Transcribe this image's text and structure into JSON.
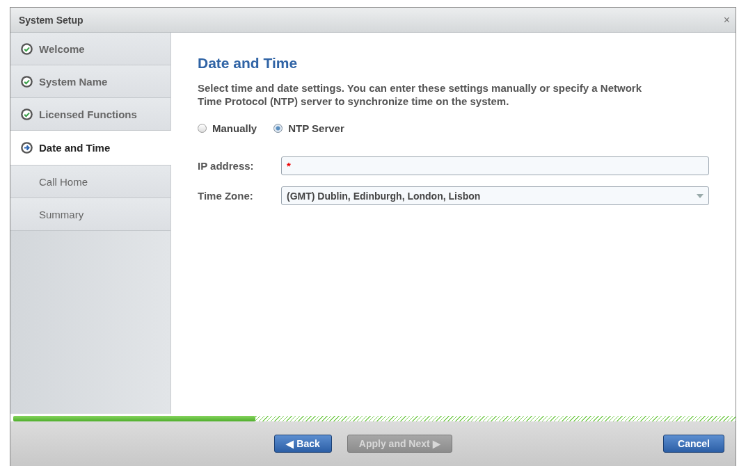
{
  "window": {
    "title": "System Setup",
    "close": "×"
  },
  "steps": [
    {
      "label": "Welcome",
      "completed": true,
      "selected": false
    },
    {
      "label": "System Name",
      "completed": true,
      "selected": false
    },
    {
      "label": "Licensed Functions",
      "completed": true,
      "selected": false
    },
    {
      "label": "Date and Time",
      "completed": false,
      "selected": true
    },
    {
      "label": "Call Home",
      "completed": false,
      "selected": false
    },
    {
      "label": "Summary",
      "completed": false,
      "selected": false
    }
  ],
  "content": {
    "heading": "Date and Time",
    "description": "Select time and date settings. You can enter these settings manually or specify a Network Time Protocol (NTP) server to synchronize time on the system.",
    "modes": [
      {
        "label": "Manually",
        "selected": false
      },
      {
        "label": "NTP Server",
        "selected": true
      }
    ],
    "ip_address": {
      "label": "IP address:",
      "required_mark": "*"
    },
    "time_zone": {
      "label": "Time Zone:",
      "value": "(GMT) Dublin, Edinburgh, London, Lisbon"
    }
  },
  "progress": {
    "level": 0.335
  },
  "buttons": [
    {
      "label": "Back",
      "arrow_before": "◀",
      "disabled": false
    },
    {
      "label": "Apply and Next",
      "arrow_after": "▶",
      "disabled": true
    }
  ],
  "cancel": {
    "label": "Cancel"
  }
}
